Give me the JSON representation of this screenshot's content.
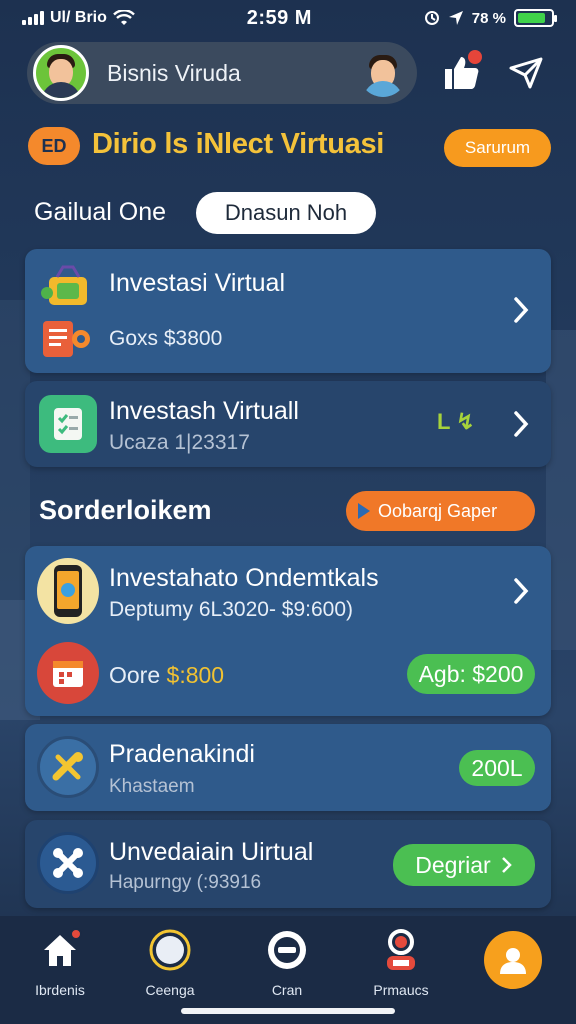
{
  "status_bar": {
    "carrier": "Ul/ Brio",
    "time": "2:59 M",
    "battery_text": "78 %",
    "battery_level": 0.85
  },
  "header": {
    "title": "Bisnis Viruda"
  },
  "banner": {
    "icon_text": "ED",
    "title": "Dirio ls iNlect Virtuasi",
    "button_label": "Sarurum"
  },
  "subheader": {
    "label": "Gailual One",
    "pill": "Dnasun Noh"
  },
  "cards": [
    {
      "title": "Investasi Virtual",
      "subtitle": "Goxs $3800"
    },
    {
      "title": "Investash Virtuall",
      "subtitle": "Ucaza 1|23317",
      "tag": "L ↯"
    }
  ],
  "section2": {
    "title": "Sorderloikem",
    "button_label": "Oobarqj Gaper"
  },
  "card3": {
    "title": "Investahato Ondemtkals",
    "subtitle": "Deptumy 6L3020- $9:600)",
    "price_label": "Oore ",
    "price_value": "$:800",
    "pill": "Agb: $200"
  },
  "card4": {
    "title": "Pradenakindi",
    "subtitle": "Khastaem",
    "pill": "200L"
  },
  "card5": {
    "title": "Unvedaiain Uirtual",
    "subtitle": "Hapurngy (:93916",
    "button_label": "Degriar"
  },
  "nav": {
    "items": [
      {
        "label": "Ibrdenis",
        "icon": "home-icon"
      },
      {
        "label": "Ceenga",
        "icon": "compass-icon"
      },
      {
        "label": "Cran",
        "icon": "minus-circle-icon"
      },
      {
        "label": "Prmaucs",
        "icon": "person-icon"
      }
    ],
    "profile_icon": "user-icon"
  },
  "colors": {
    "accent_orange": "#f4892c",
    "banner_yellow": "#f4c23a",
    "green": "#4bbf52",
    "card_blue": "#2f5a8b"
  }
}
